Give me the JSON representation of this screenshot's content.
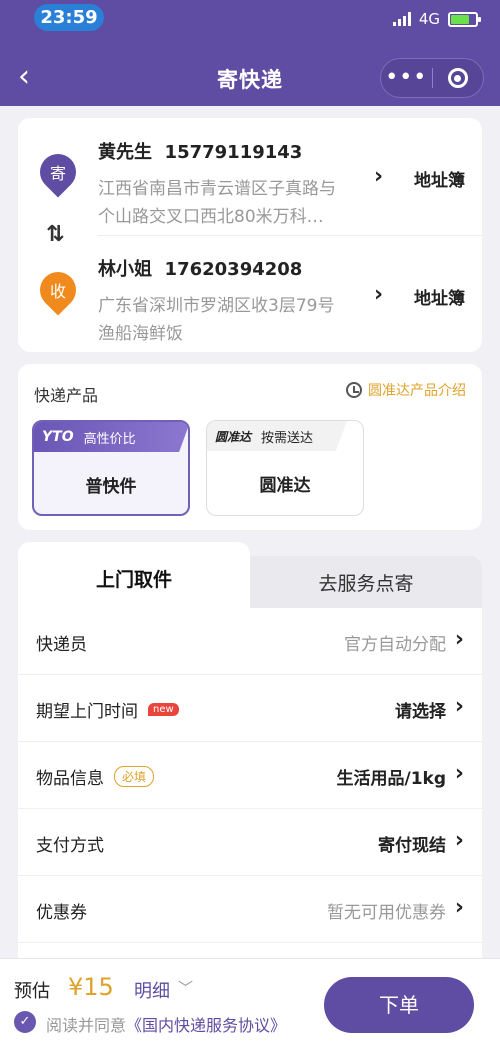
{
  "status_bar": {
    "time": "23:59",
    "network": "4G"
  },
  "header": {
    "back_icon": "chevron-left-icon",
    "title": "寄快递",
    "more_icon": "more-dots-icon",
    "close_icon": "target-circle-icon"
  },
  "sender": {
    "badge": "寄",
    "name": "黄先生",
    "phone": "15779119143",
    "address_line1": "江西省南昌市青云谱区子真路与",
    "address_line2": "个山路交叉口西北80米万科…",
    "book_label": "地址簿",
    "color": "#5f4ca3"
  },
  "receiver": {
    "badge": "收",
    "name": "林小姐",
    "phone": "17620394208",
    "address_line1": "广东省深圳市罗湖区收3层79号",
    "address_line2": "渔船海鲜饭",
    "book_label": "地址簿",
    "color": "#f08a1c"
  },
  "products": {
    "label": "快递产品",
    "intro": "圆准达产品介绍",
    "items": [
      {
        "logo": "YTO",
        "tag": "高性价比",
        "name": "普快件",
        "selected": true
      },
      {
        "logo": "圆准达",
        "tag": "按需送达",
        "name": "圆准达",
        "selected": false
      }
    ]
  },
  "tabs": [
    {
      "label": "上门取件",
      "active": true
    },
    {
      "label": "去服务点寄",
      "active": false
    }
  ],
  "form_rows": [
    {
      "label": "快递员",
      "value": "官方自动分配",
      "style": "grey"
    },
    {
      "label": "期望上门时间",
      "badge": "new",
      "value": "请选择",
      "style": "strong"
    },
    {
      "label": "物品信息",
      "badge": "必填",
      "value": "生活用品/1kg",
      "style": "strong"
    },
    {
      "label": "支付方式",
      "value": "寄付现结",
      "style": "strong"
    },
    {
      "label": "优惠券",
      "value": "暂无可用优惠券",
      "style": "grey"
    }
  ],
  "bottom": {
    "estimate_label": "预估",
    "price": "¥15",
    "detail_label": "明细",
    "agree_prefix": "阅读并同意",
    "agree_link": "《国内快递服务协议》",
    "submit_label": "下单"
  },
  "colors": {
    "brand": "#5f4ca3",
    "accent": "#e0a22a",
    "new_badge": "#e8453c"
  }
}
